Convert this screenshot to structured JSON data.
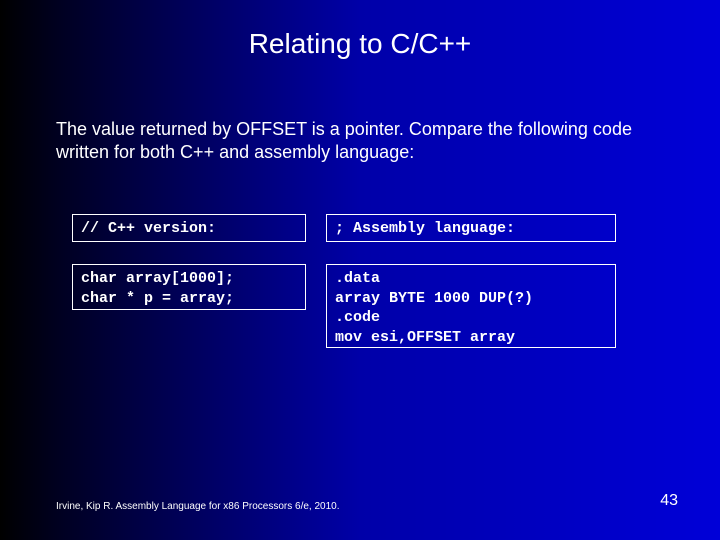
{
  "title": "Relating to C/C++",
  "body": "The value returned by OFFSET is a pointer. Compare the following code written for both C++ and assembly language:",
  "cpp_header": "// C++ version:",
  "asm_header": "; Assembly language:",
  "cpp_code": "char array[1000];\nchar * p = array;",
  "asm_code": ".data\narray BYTE 1000 DUP(?)\n.code\nmov esi,OFFSET array",
  "footer": "Irvine, Kip R. Assembly Language for x86 Processors 6/e, 2010.",
  "page_number": "43"
}
